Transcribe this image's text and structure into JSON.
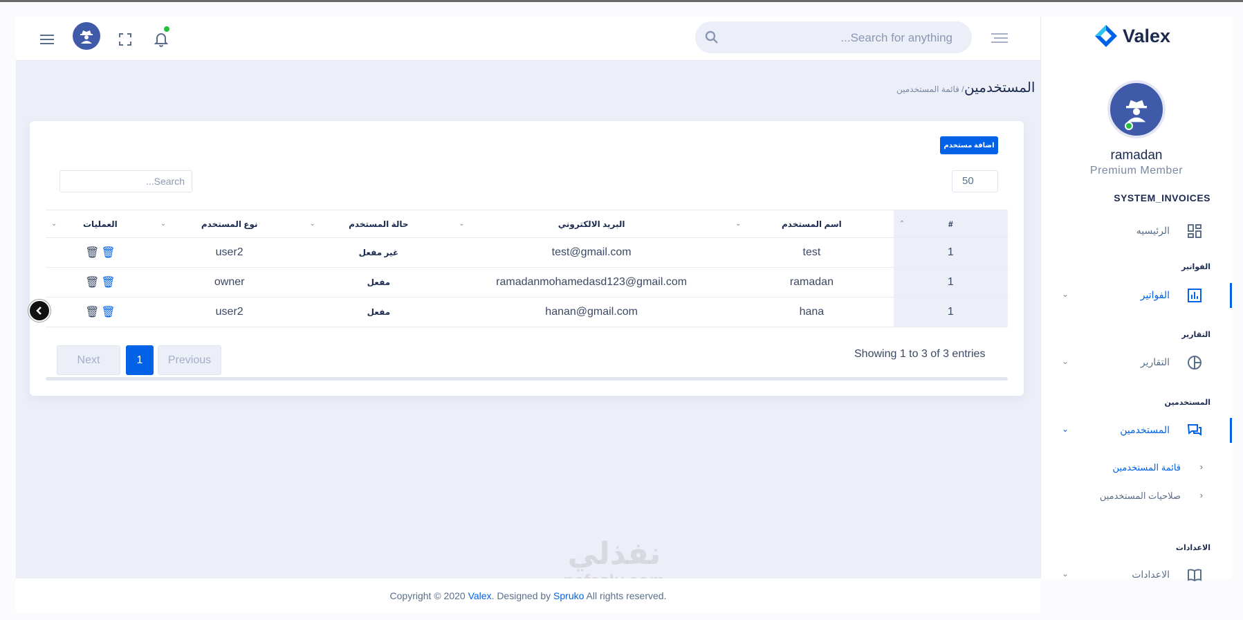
{
  "search": {
    "placeholder": "Search for anything..."
  },
  "sidebar": {
    "brand": "Valex",
    "user_name": "ramadan",
    "user_role": "Premium Member",
    "section": "SYSTEM_INVOICES",
    "home": "الرئيسيه",
    "cat_invoices": "الفواتير",
    "invoices": "الفواتير",
    "cat_reports": "التقارير",
    "reports": "التقارير",
    "cat_users": "المستخدمين",
    "users": "المستخدمين",
    "sub_users_list": "قائمة المستخدمين",
    "sub_users_perms": "صلاحيات المستخدمين",
    "cat_settings": "الاعدادات",
    "settings": "الاعدادات"
  },
  "page": {
    "title": "المستخدمين",
    "breadcrumb": "/ قائمة المستخدمين"
  },
  "table": {
    "add_button": "اضافة مستخدم",
    "page_length": "50",
    "search_placeholder": "Search...",
    "headers": [
      "#",
      "اسم المستخدم",
      "البريد الالكتروني",
      "حالة المستخدم",
      "نوع المستخدم",
      "العمليات"
    ],
    "rows": [
      {
        "num": "1",
        "name": "test",
        "email": "test@gmail.com",
        "status": "غير مفعل",
        "type": "user2"
      },
      {
        "num": "1",
        "name": "ramadan",
        "email": "ramadanmohamedasd123@gmail.com",
        "status": "مفعل",
        "type": "owner"
      },
      {
        "num": "1",
        "name": "hana",
        "email": "hanan@gmail.com",
        "status": "مفعل",
        "type": "user2"
      }
    ],
    "info": "Showing 1 to 3 of 3 entries",
    "previous": "Previous",
    "page": "1",
    "next": "Next"
  },
  "footer": {
    "prefix": "Copyright © 2020 ",
    "brand": "Valex",
    "middle": ". Designed by ",
    "designer": "Spruko",
    "suffix": " All rights reserved."
  },
  "watermark": {
    "line1": "نفذلي",
    "line2": "nafezly.com"
  },
  "colors": {
    "primary": "#0162e8",
    "avatar": "#3f5aa8",
    "online": "#22c03c",
    "bg": "#eceef8"
  }
}
